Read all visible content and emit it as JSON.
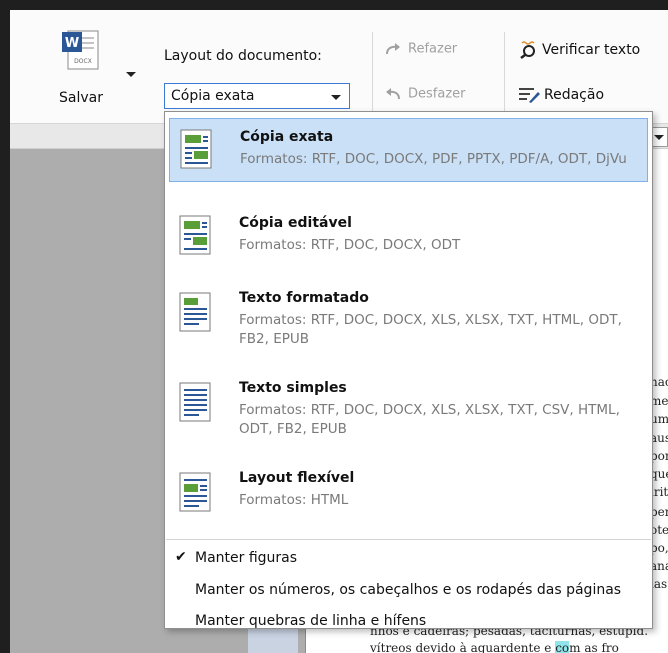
{
  "ribbon": {
    "save_label": "Salvar",
    "docx_icon_text": "DOCX",
    "layout_label": "Layout do documento:",
    "layout_selected": "Cópia exata",
    "redo_label": "Refazer",
    "undo_label": "Desfazer",
    "verify_label": "Verificar texto",
    "redacao_label": "Redação"
  },
  "dropdown": {
    "options": [
      {
        "title": "Cópia exata",
        "formats": "Formatos: RTF, DOC, DOCX, PDF, PPTX, PDF/A, ODT, DjVu",
        "selected": true
      },
      {
        "title": "Cópia editável",
        "formats": "Formatos: RTF, DOC, DOCX, ODT",
        "selected": false
      },
      {
        "title": "Texto formatado",
        "formats": "Formatos: RTF, DOC, DOCX, XLS, XLSX, TXT, HTML, ODT, FB2, EPUB",
        "selected": false
      },
      {
        "title": "Texto simples",
        "formats": "Formatos: RTF, DOC, DOCX, XLS, XLSX, TXT, CSV, HTML, ODT, FB2, EPUB",
        "selected": false
      },
      {
        "title": "Layout flexível",
        "formats": "Formatos: HTML",
        "selected": false
      }
    ],
    "checks": [
      {
        "label": "Manter figuras",
        "checked": true
      },
      {
        "label": "Manter os números, os cabeçalhos e os rodapés das páginas",
        "checked": false
      },
      {
        "label": "Manter quebras de linha e hífens",
        "checked": false
      }
    ],
    "check_mark": "✔"
  },
  "document": {
    "fragments": [
      "nac",
      "men",
      "uma",
      "aus",
      "por",
      "que",
      "irit",
      "pem",
      "otec",
      "po,",
      "ana",
      "las",
      "nhos e cadeiras; pesadas, taciturnas, estupid."
    ],
    "last_line_a": "vítreos devido à aguardente e ",
    "last_line_hl": "co",
    "last_line_b": "m as fro"
  },
  "colors": {
    "accent": "#3b7ad6",
    "selected_bg": "#c9e0f7",
    "word_blue": "#2b5797",
    "icon_green": "#5a9e3a"
  }
}
